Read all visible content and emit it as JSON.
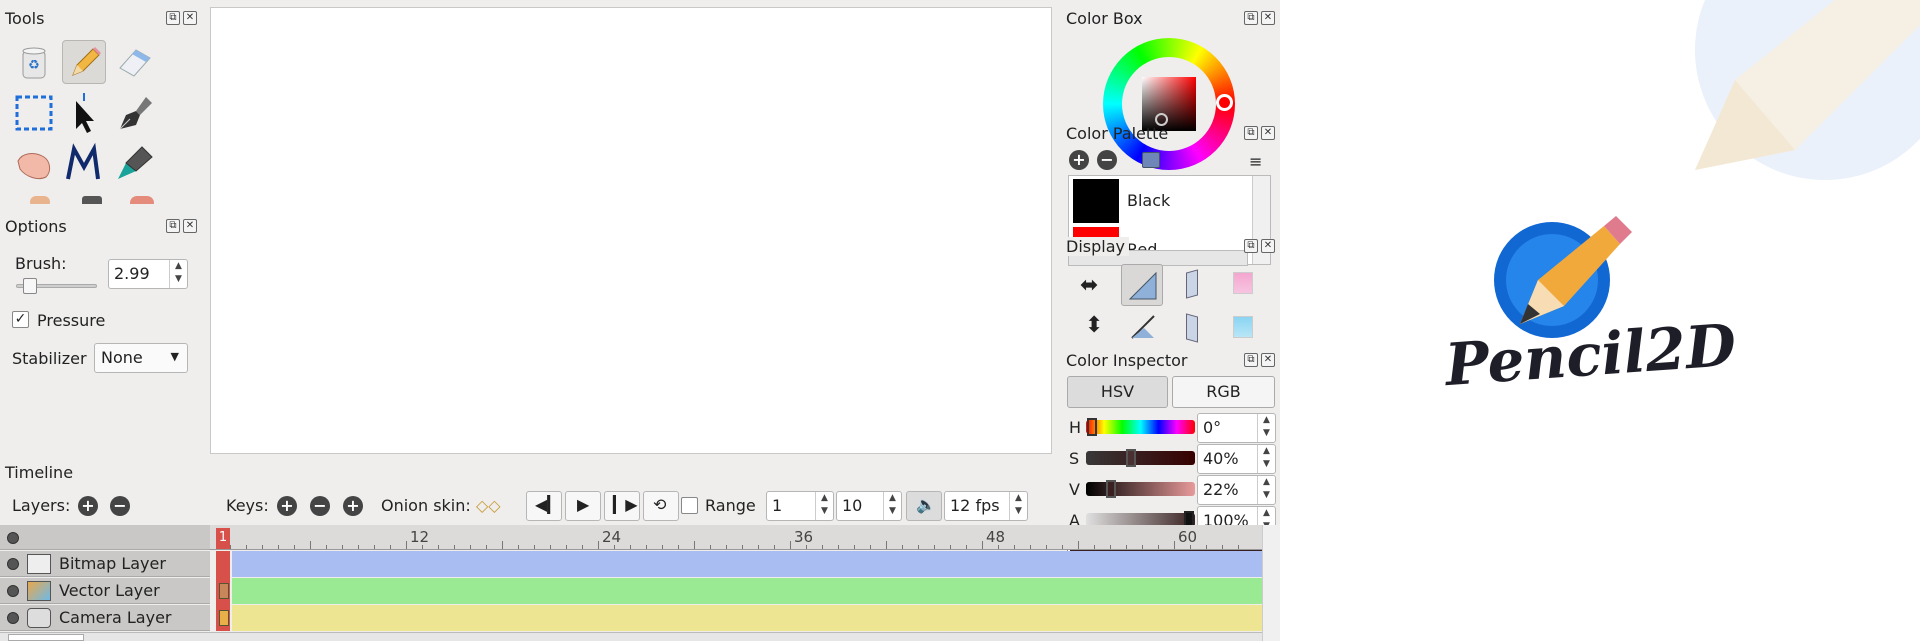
{
  "tools_panel": {
    "title": "Tools"
  },
  "options_panel": {
    "title": "Options",
    "brush_label": "Brush:",
    "brush_value": "2.99",
    "pressure_label": "Pressure",
    "pressure_checked": "✓",
    "stabilizer_label": "Stabilizer",
    "stabilizer_value": "None"
  },
  "color_box": {
    "title": "Color Box"
  },
  "color_palette": {
    "title": "Color Palette",
    "items": [
      {
        "name": "Black",
        "color": "#000000"
      },
      {
        "name": "Red",
        "color": "#ff0000"
      }
    ]
  },
  "display_panel": {
    "title": "Display"
  },
  "color_inspector": {
    "title": "Color Inspector",
    "tabs": [
      "HSV",
      "RGB"
    ],
    "rows": [
      {
        "label": "H",
        "value": "0°"
      },
      {
        "label": "S",
        "value": "40%"
      },
      {
        "label": "V",
        "value": "22%"
      },
      {
        "label": "A",
        "value": "100%"
      }
    ],
    "swatch_color": "#382020"
  },
  "timeline": {
    "title": "Timeline",
    "layers_label": "Layers:",
    "keys_label": "Keys:",
    "onion_label": "Onion skin:",
    "range_label": "Range",
    "range_start": "1",
    "range_end": "10",
    "fps": "12 fps",
    "current_frame": "1",
    "ruler_labels": [
      "12",
      "24",
      "36",
      "48",
      "60"
    ],
    "layers": [
      {
        "name": "Bitmap Layer",
        "color": "#a9bdf2"
      },
      {
        "name": "Vector Layer",
        "color": "#9aea93"
      },
      {
        "name": "Camera Layer",
        "color": "#eee592"
      }
    ]
  },
  "logo": {
    "text": "Pencil2D"
  }
}
